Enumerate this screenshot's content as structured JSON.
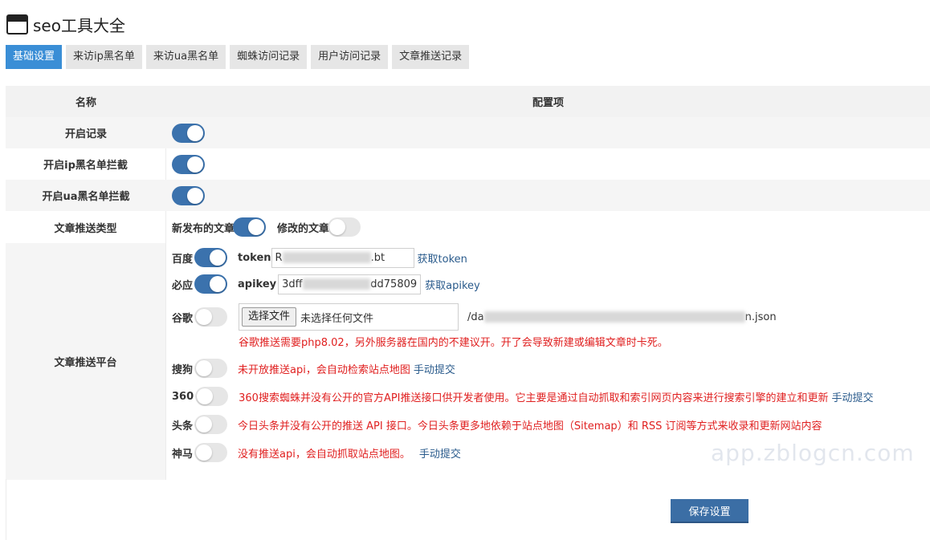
{
  "header": {
    "title": "seo工具大全",
    "icon": "window-icon"
  },
  "tabs": [
    {
      "label": "基础设置",
      "active": true
    },
    {
      "label": "来访ip黑名单",
      "active": false
    },
    {
      "label": "来访ua黑名单",
      "active": false
    },
    {
      "label": "蜘蛛访问记录",
      "active": false
    },
    {
      "label": "用户访问记录",
      "active": false
    },
    {
      "label": "文章推送记录",
      "active": false
    }
  ],
  "table": {
    "col_name": "名称",
    "col_config": "配置项",
    "rows": {
      "enable_log": {
        "label": "开启记录",
        "on": true
      },
      "ip_block": {
        "label": "开启ip黑名单拦截",
        "on": true
      },
      "ua_block": {
        "label": "开启ua黑名单拦截",
        "on": true
      },
      "push_type": {
        "label": "文章推送类型",
        "new_post": {
          "label": "新发布的文章",
          "on": true
        },
        "edit_post": {
          "label": "修改的文章",
          "on": false
        }
      },
      "platform": {
        "label": "文章推送平台",
        "baidu": {
          "label": "百度",
          "on": true,
          "field_label": "token",
          "value_start": "R",
          "value_end": ".bt",
          "link": "获取token"
        },
        "bing": {
          "label": "必应",
          "on": true,
          "field_label": "apikey",
          "value_start": "3dff",
          "value_end": "dd75809",
          "link": "获取apikey"
        },
        "google": {
          "label": "谷歌",
          "on": false,
          "file_button": "选择文件",
          "file_status": "未选择任何文件",
          "path_start": "/da",
          "path_end": "n.json",
          "note": "谷歌推送需要php8.02，另外服务器在国内的不建议开。开了会导致新建或编辑文章时卡死。"
        },
        "sogou": {
          "label": "搜狗",
          "on": false,
          "note": "未开放推送api，会自动检索站点地图",
          "link": "手动提交"
        },
        "so360": {
          "label": "360",
          "on": false,
          "note": "360搜索蜘蛛并没有公开的官方API推送接口供开发者使用。它主要是通过自动抓取和索引网页内容来进行搜索引擎的建立和更新",
          "link": "手动提交"
        },
        "toutiao": {
          "label": "头条",
          "on": false,
          "note": "今日头条并没有公开的推送 API 接口。今日头条更多地依赖于站点地图（Sitemap）和 RSS 订阅等方式来收录和更新网站内容"
        },
        "shenma": {
          "label": "神马",
          "on": false,
          "note": "没有推送api，会自动抓取站点地图。",
          "link": "手动提交"
        }
      }
    }
  },
  "save_button": "保存设置",
  "watermark": "app.zblogcn.com",
  "colors": {
    "tab_active": "#3a8ed6",
    "toggle_on": "#3b72ad",
    "note_red": "#e02020",
    "link": "#2a5b8c"
  }
}
